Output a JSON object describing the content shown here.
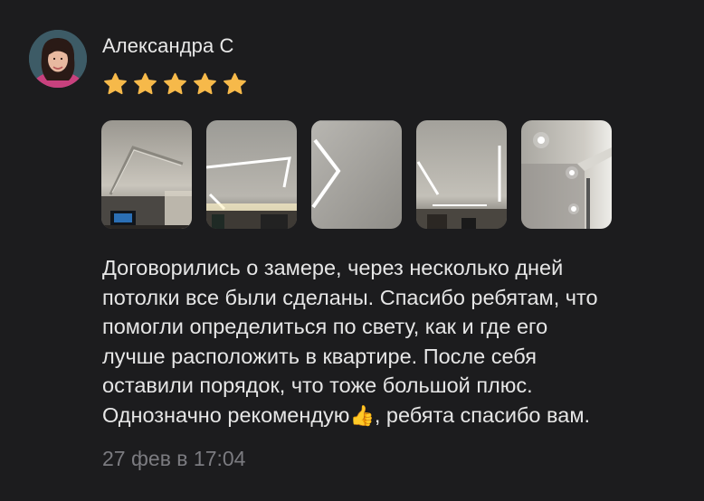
{
  "review": {
    "author": "Александра С",
    "rating": 5,
    "rating_max": 5,
    "star_color": "#f6b94a",
    "photos": [
      {
        "alt": "photo-1"
      },
      {
        "alt": "photo-2"
      },
      {
        "alt": "photo-3"
      },
      {
        "alt": "photo-4"
      },
      {
        "alt": "photo-5"
      }
    ],
    "text_lines": [
      "Договорились о замере, через несколько дней",
      "потолки все были сделаны. Спасибо ребятам, что",
      "помогли определиться по свету, как и где его",
      "лучше расположить в квартире. После себя",
      "оставили порядок, что тоже большой плюс.",
      "Однозначно рекомендую"
    ],
    "text_emoji": "👍",
    "text_tail": ", ребята спасибо вам.",
    "date": "27 фев в 17:04"
  }
}
